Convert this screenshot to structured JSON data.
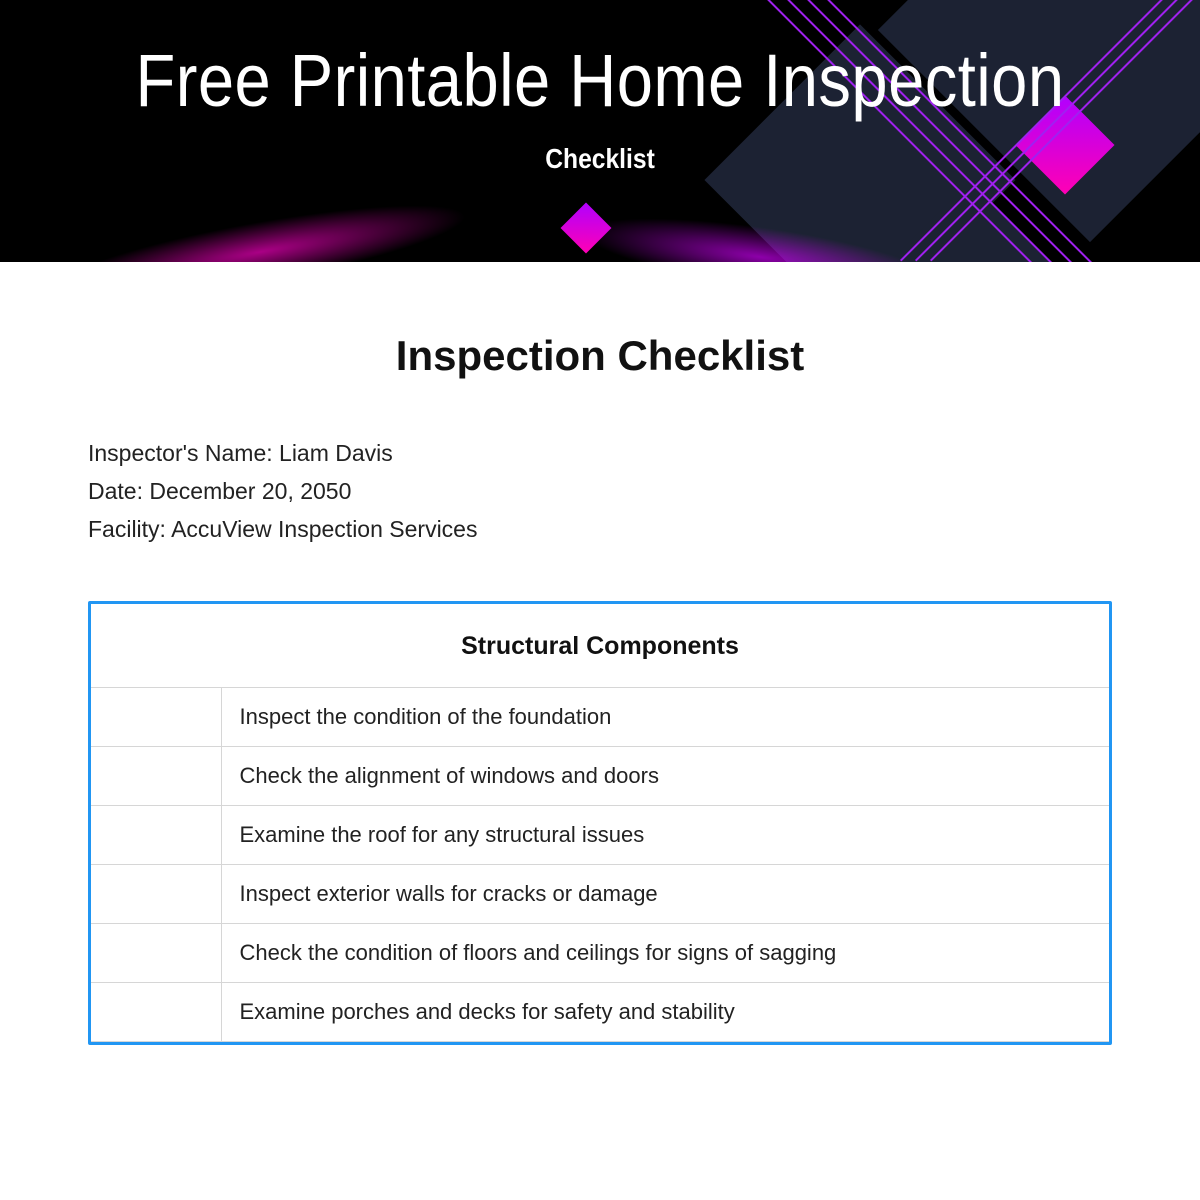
{
  "hero": {
    "title": "Free Printable Home Inspection",
    "subtitle": "Checklist"
  },
  "doc": {
    "title": "Inspection Checklist",
    "meta": {
      "inspector_label": "Inspector's Name:",
      "inspector_value": "Liam Davis",
      "date_label": "Date:",
      "date_value": "December 20, 2050",
      "facility_label": "Facility:",
      "facility_value": "AccuView Inspection Services"
    },
    "section": {
      "title": "Structural Components",
      "items": [
        "Inspect the condition of the foundation",
        "Check the alignment of windows and doors",
        "Examine the roof for any structural issues",
        "Inspect exterior walls for cracks or damage",
        "Check the condition of floors and ceilings for signs of sagging",
        "Examine porches and decks for safety and stability"
      ]
    }
  }
}
